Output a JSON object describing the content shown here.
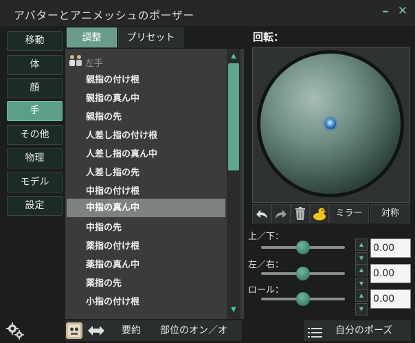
{
  "window": {
    "title": "アバターとアニメッシュのポーザー",
    "minimize_glyph": "–",
    "close_glyph": "✕"
  },
  "sidebar": {
    "items": [
      {
        "label": "移動",
        "active": false
      },
      {
        "label": "体",
        "active": false
      },
      {
        "label": "顔",
        "active": false
      },
      {
        "label": "手",
        "active": true
      },
      {
        "label": "その他",
        "active": false
      },
      {
        "label": "物理",
        "active": false
      },
      {
        "label": "モデル",
        "active": false
      },
      {
        "label": "設定",
        "active": false
      }
    ]
  },
  "tabs": [
    {
      "label": "調整",
      "active": true
    },
    {
      "label": "プリセット",
      "active": false
    }
  ],
  "joint_list": {
    "header": "左手",
    "items": [
      "親指の付け根",
      "親指の真ん中",
      "親指の先",
      "人差し指の付け根",
      "人差し指の真ん中",
      "人差し指の先",
      "中指の付け根",
      "中指の真ん中",
      "中指の先",
      "薬指の付け根",
      "薬指の真ん中",
      "薬指の先",
      "小指の付け根"
    ],
    "selected_index": 7
  },
  "bottom_left": {
    "summary_label": "要約",
    "toggle_parts_label": "部位のオン／オ"
  },
  "rotation": {
    "label": "回転：",
    "mirror_label": "ミラー",
    "symmetry_label": "対称",
    "axes": [
      {
        "label": "上／下：",
        "value": "0.00",
        "level": 0.5
      },
      {
        "label": "左／右：",
        "value": "0.00",
        "level": 0.5
      },
      {
        "label": "ロール：",
        "value": "0.00",
        "level": 0.5
      }
    ]
  },
  "my_pose_label": "自分のポーズ",
  "colors": {
    "accent": "#5a9f86",
    "selected_row": "#7e8181",
    "list_bg": "#3a3c3c"
  }
}
